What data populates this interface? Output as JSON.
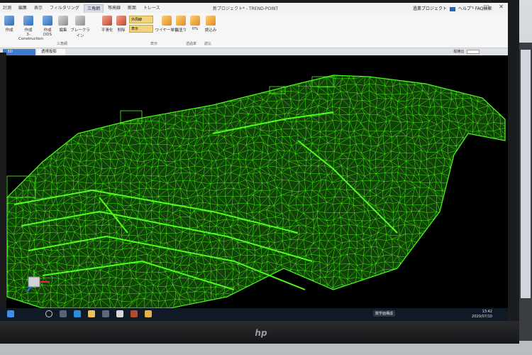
{
  "menu_items": [
    "計測",
    "編集",
    "表示",
    "フィルタリング",
    "三角網",
    "等高線",
    "断面",
    "トレース"
  ],
  "active_menu_index": 4,
  "window_title": "新プロジェクト* - TREND-POINT",
  "title_right": {
    "project": "過業プロジェクト",
    "help": "ヘルプ・FAQ検索"
  },
  "window_buttons": [
    "–",
    "□",
    "✕"
  ],
  "ribbon_buttons": [
    {
      "label": "作成",
      "icon": "create-icon"
    },
    {
      "label": "作成\n3-Construction",
      "icon": "create-3c-icon"
    },
    {
      "label": "作成\nDDS",
      "icon": "create-dds-icon"
    },
    {
      "label": "編集",
      "icon": "edit-icon"
    },
    {
      "label": "ブレークライン",
      "icon": "breakline-icon"
    },
    {
      "label": "平滑化",
      "icon": "smooth-icon"
    },
    {
      "label": "削除",
      "icon": "delete-icon"
    },
    {
      "label": "ワイヤー単色",
      "icon": "wire-color-icon"
    },
    {
      "label": "面塗り",
      "icon": "fill-icon"
    },
    {
      "label": "0%",
      "icon": "transparency-icon"
    },
    {
      "label": "読込み",
      "icon": "load-icon"
    }
  ],
  "triangle_group": [
    "外周線",
    "表示"
  ],
  "ribbon_group_labels": [
    "三角網",
    "表示",
    "透過率",
    "読込"
  ],
  "tabs": [
    {
      "label": "3D",
      "active": true
    },
    {
      "label": "透視投影",
      "active": false
    }
  ],
  "view_control": "縦横比",
  "taskbar": {
    "ime_label": "数学面構成",
    "time": "13:42",
    "date": "2020/07/10"
  },
  "colors": {
    "wireframe": "#4cff1a",
    "viewport_bg": "#000000",
    "ribbon_bg": "#f6f6f6",
    "taskbar_bg": "#0f1a26",
    "accent": "#3b7ccf"
  }
}
